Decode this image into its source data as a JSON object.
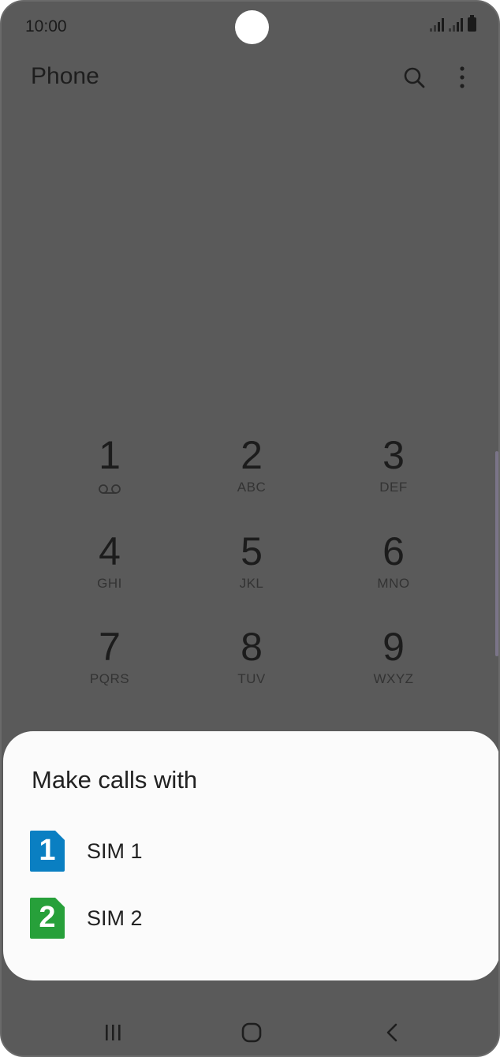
{
  "status_bar": {
    "time": "10:00"
  },
  "app_bar": {
    "title": "Phone",
    "search_icon": "search-icon",
    "more_icon": "more-vert-icon"
  },
  "dialpad": {
    "keys": [
      {
        "digit": "1",
        "letters": ""
      },
      {
        "digit": "2",
        "letters": "ABC"
      },
      {
        "digit": "3",
        "letters": "DEF"
      },
      {
        "digit": "4",
        "letters": "GHI"
      },
      {
        "digit": "5",
        "letters": "JKL"
      },
      {
        "digit": "6",
        "letters": "MNO"
      },
      {
        "digit": "7",
        "letters": "PQRS"
      },
      {
        "digit": "8",
        "letters": "TUV"
      },
      {
        "digit": "9",
        "letters": "WXYZ"
      }
    ],
    "voicemail_icon": "voicemail-icon"
  },
  "sheet": {
    "title": "Make calls with",
    "options": [
      {
        "label": "SIM 1",
        "badge": "1",
        "color": "#0a7fc2"
      },
      {
        "label": "SIM 2",
        "badge": "2",
        "color": "#27a03a"
      }
    ]
  },
  "nav_bar": {
    "recents_icon": "recents-icon",
    "home_icon": "home-icon",
    "back_icon": "back-icon"
  }
}
